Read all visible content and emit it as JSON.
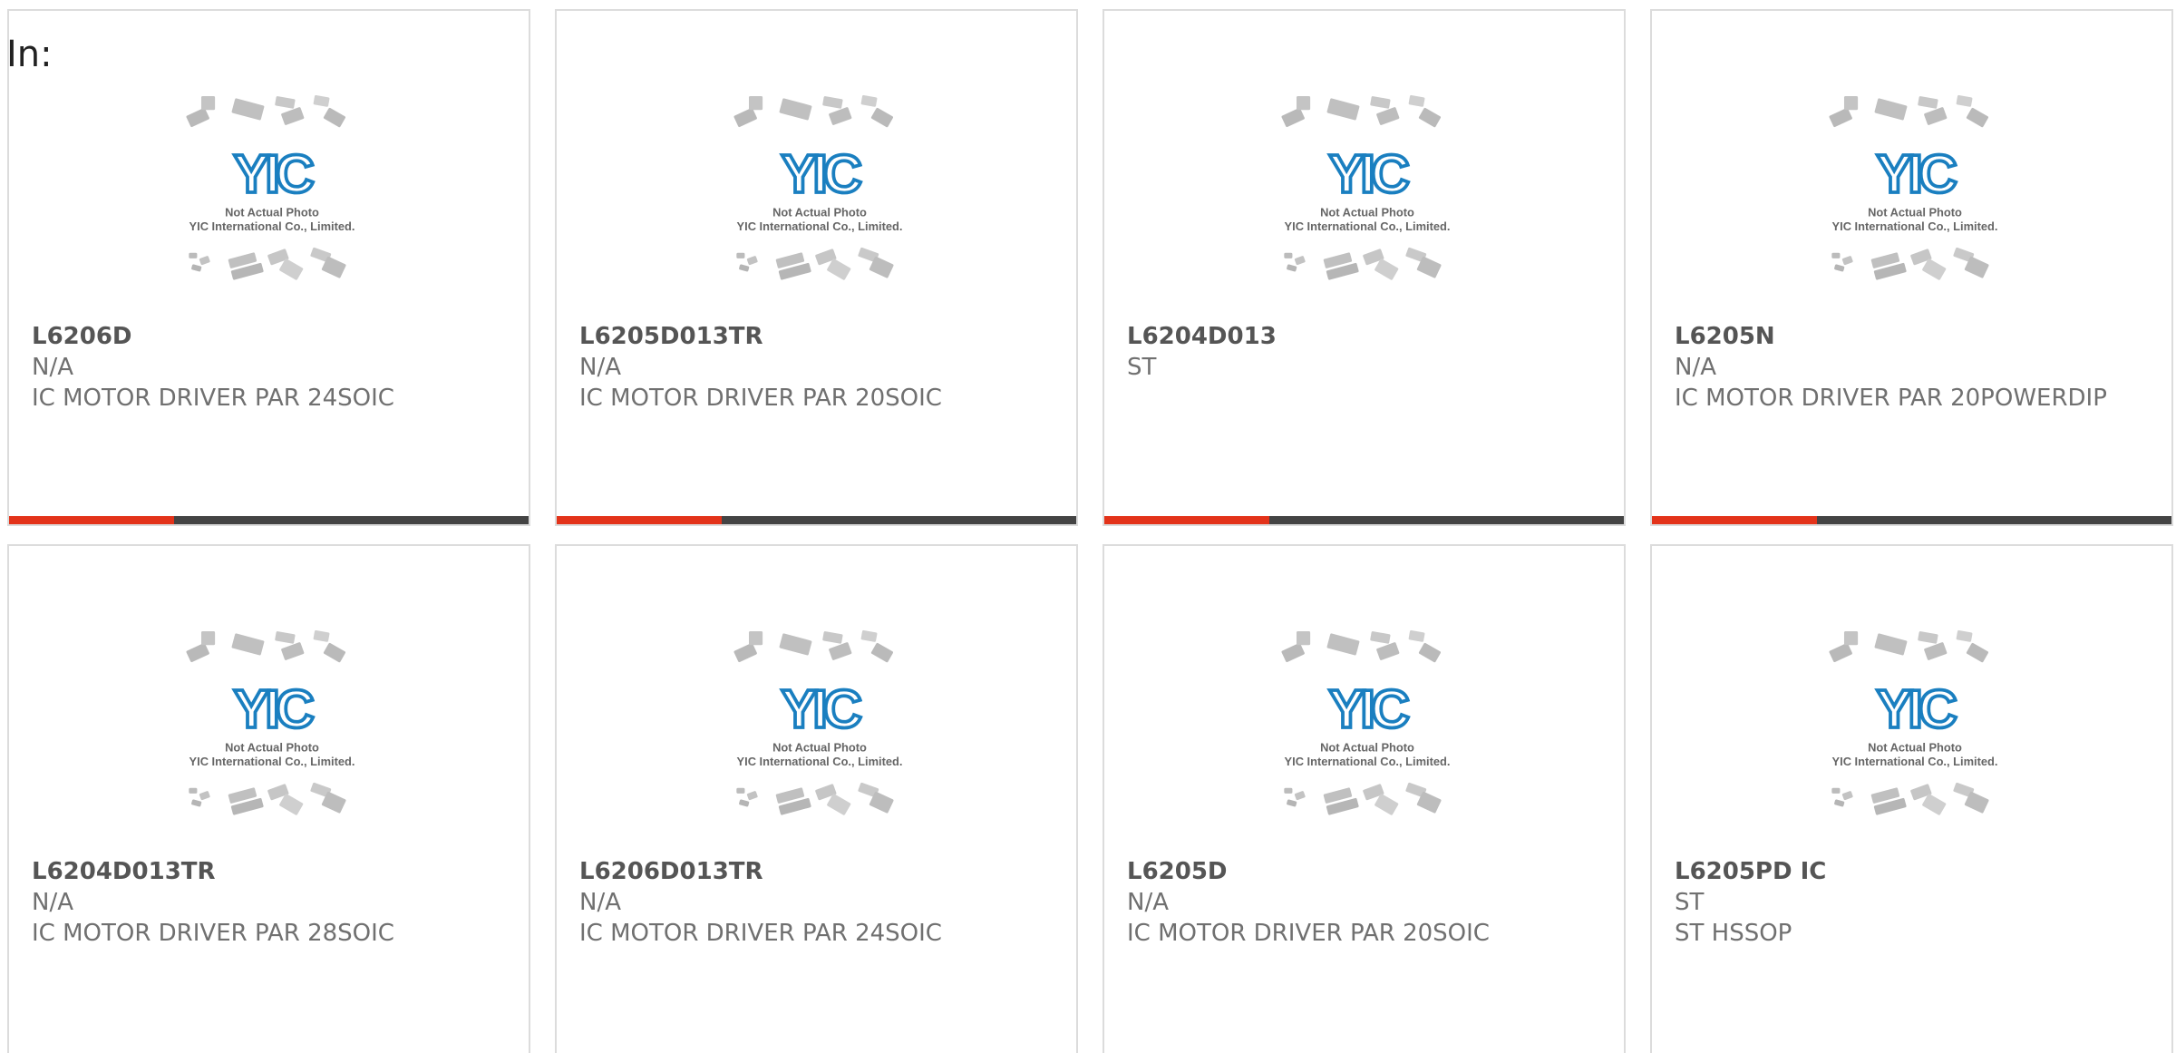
{
  "filter": {
    "label": "In:"
  },
  "placeholder_image": {
    "line1": "Not Actual Photo",
    "line2": "YIC International Co., Limited.",
    "logo_text": "YIC"
  },
  "colors": {
    "accent": "#e3331a",
    "bar": "#444444",
    "border": "#dcdcdc",
    "logo_blue": "#1a7fc0"
  },
  "products": [
    {
      "part": "L6206D",
      "maker": "N/A",
      "desc": "IC MOTOR DRIVER PAR 24SOIC"
    },
    {
      "part": "L6205D013TR",
      "maker": "N/A",
      "desc": "IC MOTOR DRIVER PAR 20SOIC"
    },
    {
      "part": "L6204D013",
      "maker": "ST",
      "desc": ""
    },
    {
      "part": "L6205N",
      "maker": "N/A",
      "desc": "IC MOTOR DRIVER PAR 20POWERDIP"
    },
    {
      "part": "L6204D013TR",
      "maker": "N/A",
      "desc": "IC MOTOR DRIVER PAR 28SOIC"
    },
    {
      "part": "L6206D013TR",
      "maker": "N/A",
      "desc": "IC MOTOR DRIVER PAR 24SOIC"
    },
    {
      "part": "L6205D",
      "maker": "N/A",
      "desc": "IC MOTOR DRIVER PAR 20SOIC"
    },
    {
      "part": "L6205PD IC",
      "maker": "ST",
      "desc": "ST HSSOP"
    }
  ]
}
